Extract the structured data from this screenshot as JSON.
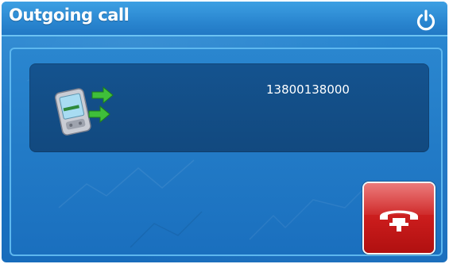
{
  "header": {
    "title": "Outgoing call",
    "power_icon": "power-icon"
  },
  "call": {
    "number": "13800138000",
    "icon": "phone-calling-icon"
  },
  "actions": {
    "hangup_icon": "hangup-phone-icon"
  },
  "colors": {
    "title_bar": "#2a86d0",
    "background": "#1f78c6",
    "card": "#14538f",
    "hangup": "#c81b1b",
    "text": "#ffffff"
  }
}
